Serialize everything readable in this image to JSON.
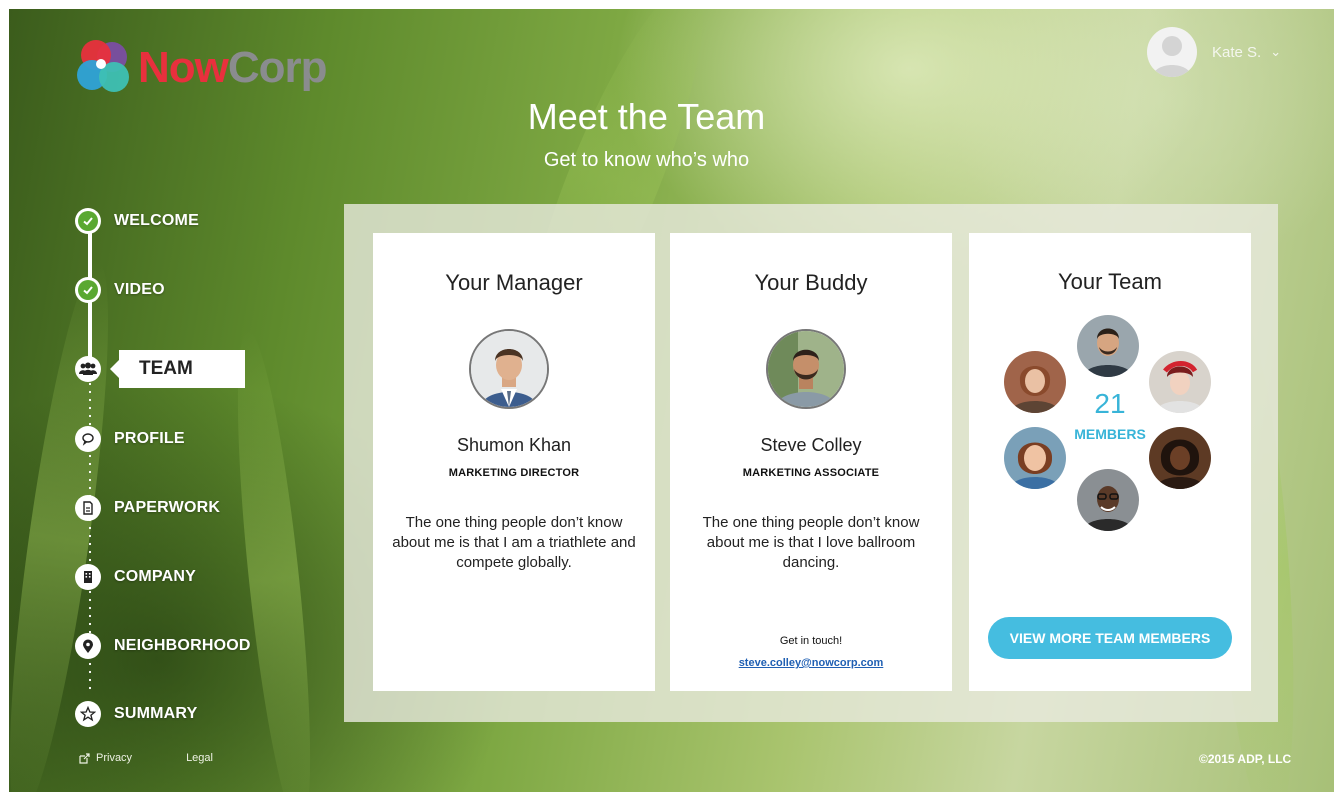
{
  "brand": {
    "name_part1": "Now",
    "name_part2": "Corp"
  },
  "user": {
    "name": "Kate S.",
    "menu_icon": "chevron-down-icon"
  },
  "hero": {
    "title": "Meet the Team",
    "subtitle": "Get to know who’s who"
  },
  "nav": {
    "items": [
      {
        "label": "WELCOME",
        "icon": "check-circle-icon",
        "state": "done"
      },
      {
        "label": "VIDEO",
        "icon": "check-circle-icon",
        "state": "done"
      },
      {
        "label": "TEAM",
        "icon": "group-icon",
        "state": "active"
      },
      {
        "label": "PROFILE",
        "icon": "speech-bubble-icon",
        "state": "upcoming"
      },
      {
        "label": "PAPERWORK",
        "icon": "document-icon",
        "state": "upcoming"
      },
      {
        "label": "COMPANY",
        "icon": "building-icon",
        "state": "upcoming"
      },
      {
        "label": "NEIGHBORHOOD",
        "icon": "map-pin-icon",
        "state": "upcoming"
      },
      {
        "label": "SUMMARY",
        "icon": "star-icon",
        "state": "upcoming"
      }
    ]
  },
  "footer": {
    "privacy": "Privacy",
    "legal": "Legal",
    "copyright": "©2015 ADP, LLC"
  },
  "cards": {
    "manager": {
      "title": "Your Manager",
      "name": "Shumon Khan",
      "role": "MARKETING DIRECTOR",
      "quote": "The one thing people don’t know about me is that I am a triathlete and compete globally."
    },
    "buddy": {
      "title": "Your Buddy",
      "name": "Steve Colley",
      "role": "MARKETING ASSOCIATE",
      "quote": "The one thing people don’t know about me is that I love ballroom dancing.",
      "contact_label": "Get in touch!",
      "email": "steve.colley@nowcorp.com"
    },
    "team": {
      "title": "Your Team",
      "count": "21",
      "count_label": "MEMBERS",
      "button": "VIEW MORE TEAM MEMBERS"
    }
  },
  "colors": {
    "accent": "#45bde0",
    "brand_red": "#e8303d",
    "check_green": "#5aa832",
    "link": "#1f5fb3"
  }
}
